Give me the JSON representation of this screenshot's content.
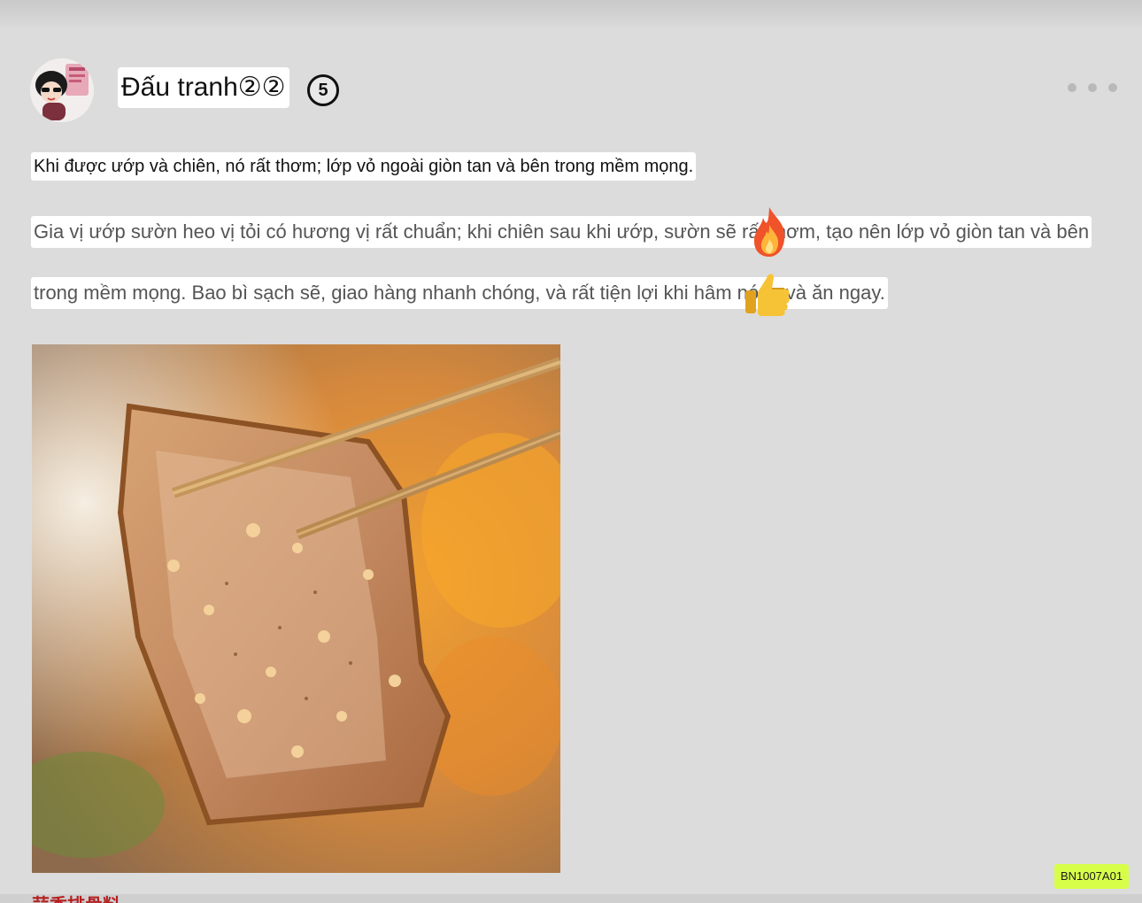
{
  "post": {
    "username": "Đấu tranh②②",
    "level_badge": "5",
    "review_lines": [
      "Khi được ướp và chiên, nó rất thơm; lớp vỏ ngoài giòn tan và bên trong mềm mọng.",
      "Gia vị ướp sườn heo vị tỏi có hương vị rất chuẩn; khi chiên sau khi ướp, sườn sẽ rất thơm, tạo nên lớp vỏ giòn tan và bên",
      "trong mềm mọng. Bao bì sạch sẽ, giao hàng nhanh chóng, và rất tiện lợi khi hâm nóng và ăn ngay."
    ],
    "emojis": [
      "fire-emoji",
      "thumbs-up-emoji"
    ],
    "product_code": "BN1007A01",
    "brand_snippet": "蒜香排骨料"
  },
  "colors": {
    "background": "#dcdcdc",
    "text_highlight": "#ffffff",
    "code_badge": "#d7ff4a"
  }
}
